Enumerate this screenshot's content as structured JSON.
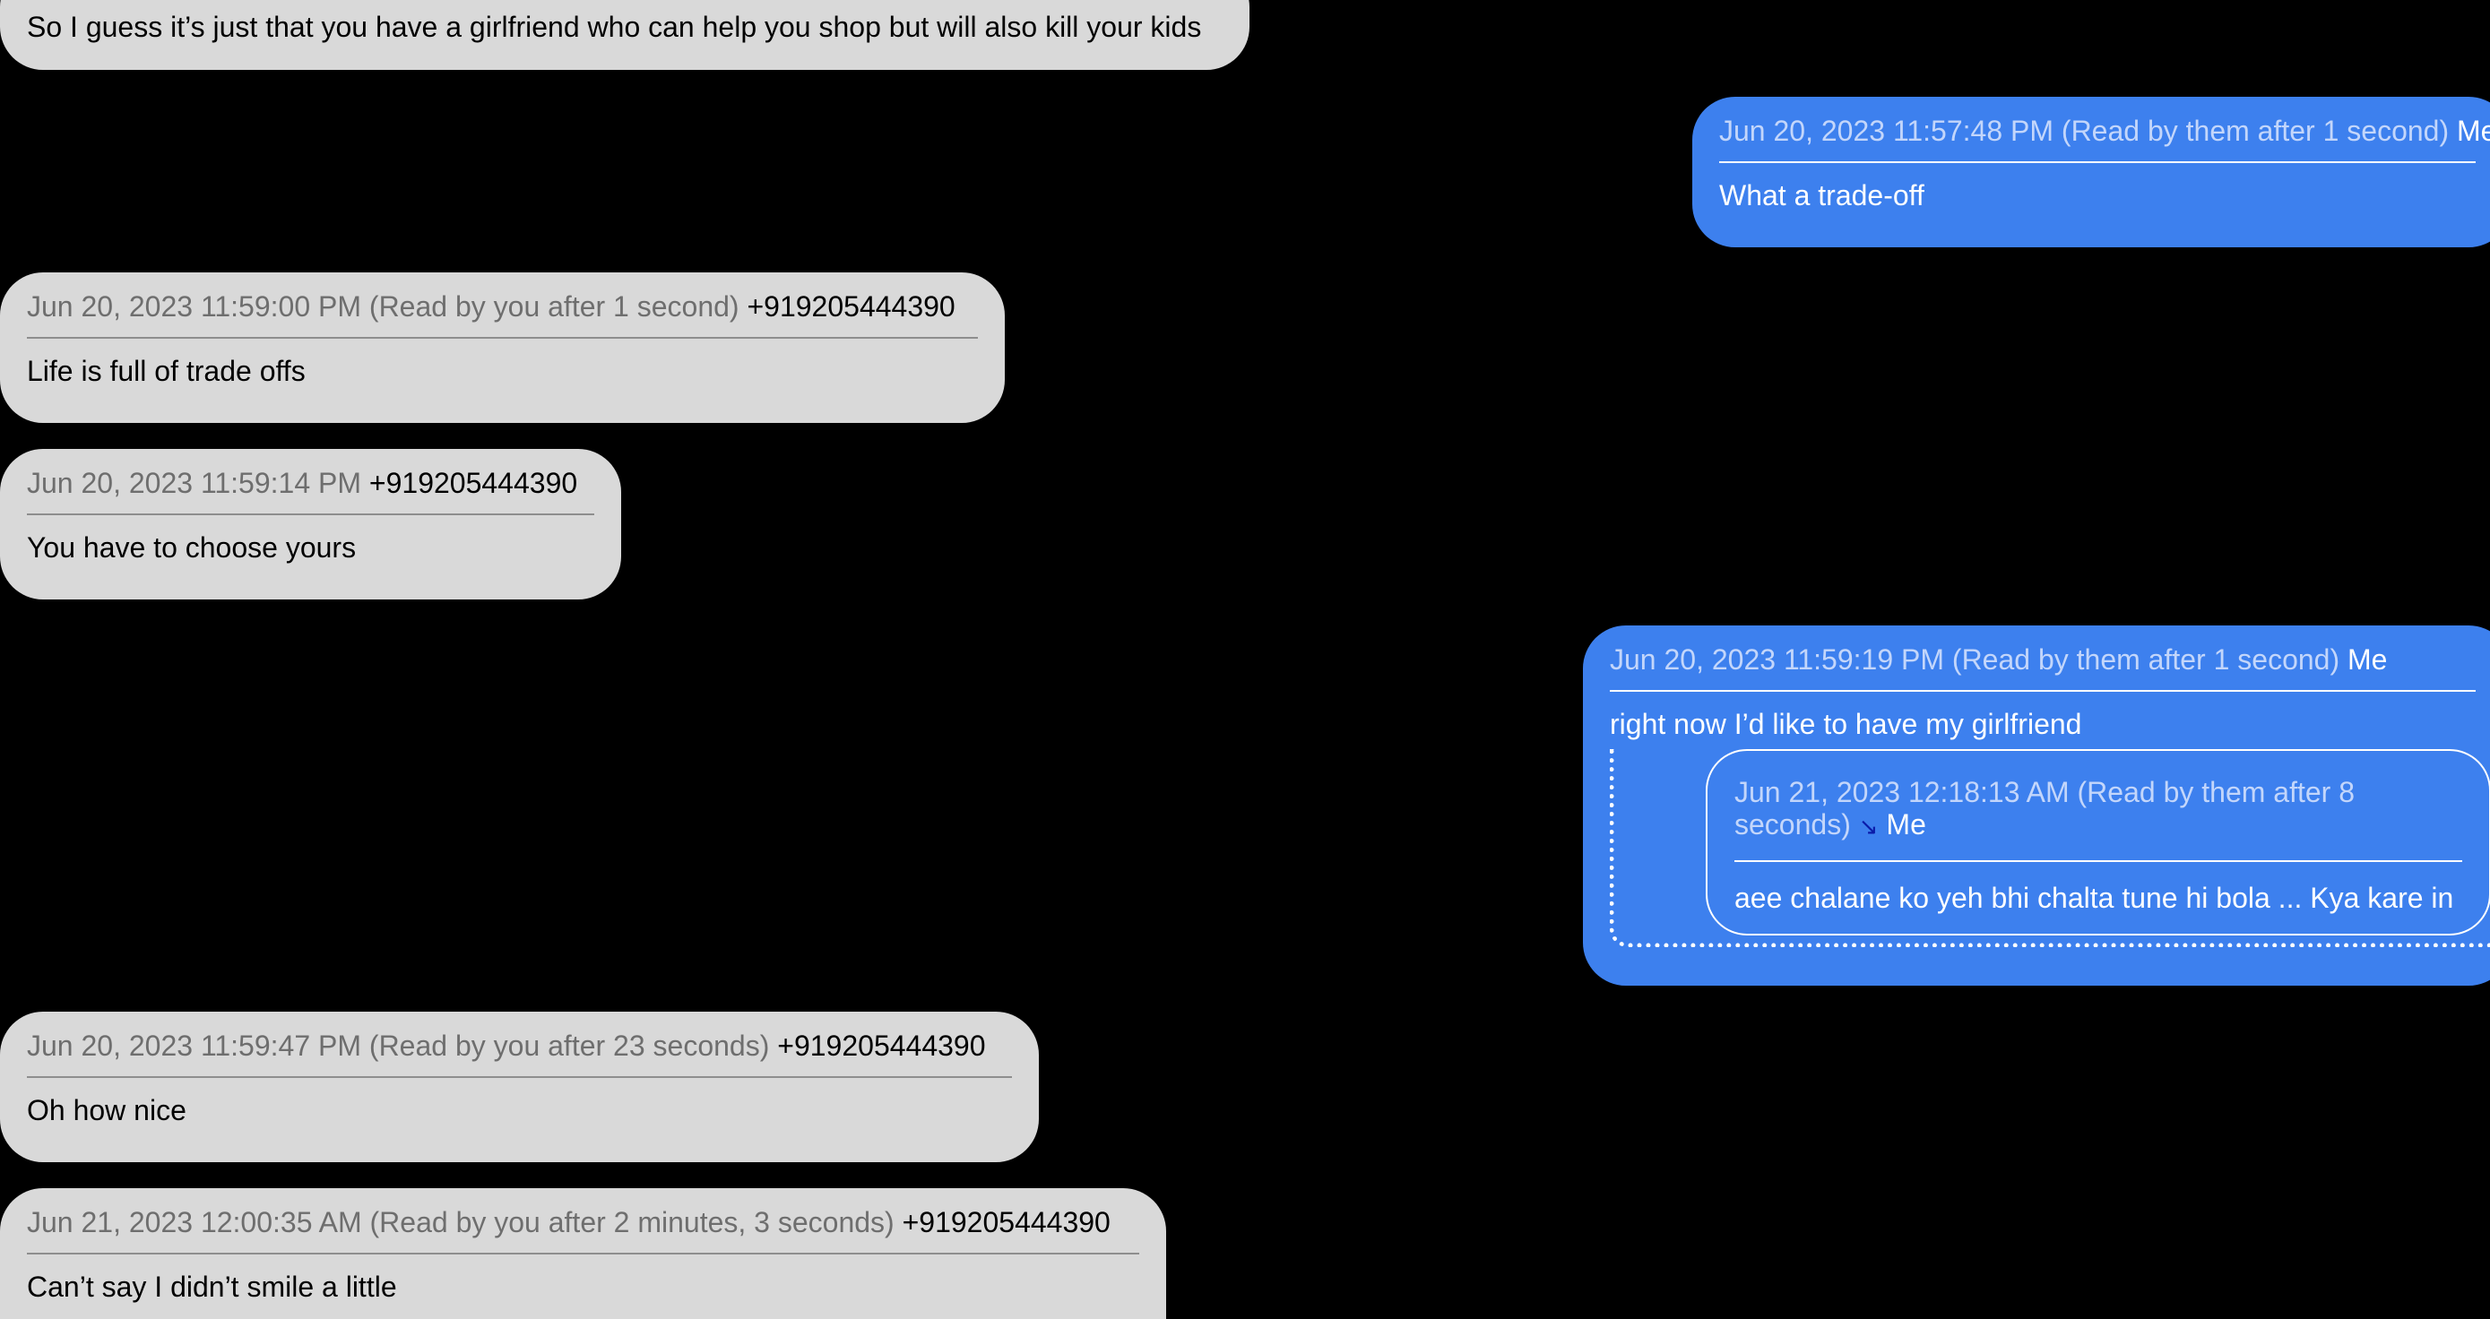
{
  "messages": [
    {
      "direction": "received",
      "text": "So I guess it’s just that you have a girlfriend who can help you shop but will also kill your kids"
    },
    {
      "direction": "sent",
      "timestamp": "Jun 20, 2023 11:57:48 PM (Read by them after 1 second)",
      "sender": "Me",
      "text": "What a trade-off"
    },
    {
      "direction": "received",
      "timestamp": "Jun 20, 2023 11:59:00 PM (Read by you after 1 second)",
      "sender": "+919205444390",
      "text": "Life is full of trade offs"
    },
    {
      "direction": "received",
      "timestamp": "Jun 20, 2023 11:59:14 PM",
      "sender": "+919205444390",
      "text": "You have to choose yours"
    },
    {
      "direction": "sent",
      "timestamp": "Jun 20, 2023 11:59:19 PM (Read by them after 1 second)",
      "sender": "Me",
      "text": "right now I’d like to have my girlfriend",
      "reply": {
        "timestamp": "Jun 21, 2023 12:18:13 AM (Read by them after 8 seconds)",
        "link_icon": "↘",
        "sender": "Me",
        "text": "aee chalane ko yeh bhi chalta tune hi bola ... Kya kare in"
      }
    },
    {
      "direction": "received",
      "timestamp": "Jun 20, 2023 11:59:47 PM (Read by you after 23 seconds)",
      "sender": "+919205444390",
      "text": "Oh how nice"
    },
    {
      "direction": "received",
      "timestamp": "Jun 21, 2023 12:00:35 AM (Read by you after 2 minutes, 3 seconds)",
      "sender": "+919205444390",
      "text": "Can’t say I didn’t smile a little"
    }
  ],
  "colors": {
    "background": "#000000",
    "received_bubble": "#d9d9d9",
    "sent_bubble": "#3d80ee",
    "received_meta": "#6e6e6e",
    "sent_meta": "#c3d6fb"
  }
}
